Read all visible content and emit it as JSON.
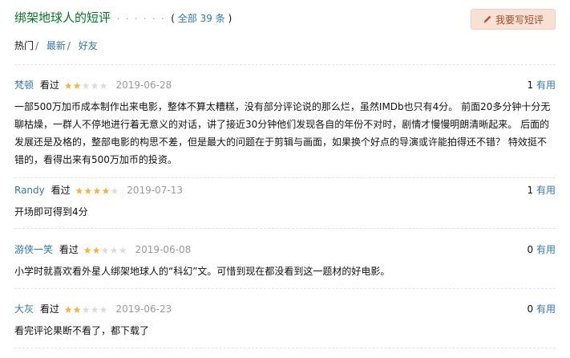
{
  "header": {
    "title": "绑架地球人的短评",
    "dots": "· · · · · ·",
    "count_prefix": "全部",
    "count_value": "39",
    "count_suffix": "条",
    "write_button": "我要写短评",
    "write_icon": "pencil-icon"
  },
  "tabs": [
    {
      "label": "热门",
      "active": true
    },
    {
      "label": "最新",
      "active": false
    },
    {
      "label": "好友",
      "active": false
    }
  ],
  "rating_colors": {
    "star_on": "#f7b13c",
    "star_off": "#dcdcdc",
    "link": "#37a"
  },
  "comments": [
    {
      "author": "梵顿",
      "status": "看过",
      "rating": 2,
      "date": "2019-06-28",
      "votes": "1",
      "vote_label": "有用",
      "content": "一部500万加币成本制作出来电影，整体不算太糟糕，没有部分评论说的那么烂，虽然IMDb也只有4分。 前面20多分钟十分无聊枯燥，一群人不停地进行着无意义的对话，讲了接近30分钟他们发现各自的年份不对时，剧情才慢慢明朗清晰起来。 后面的发展还是及格的，整部电影的构思不差，但是最大的问题在于剪辑与画面，如果换个好点的导演或许能拍得还不错？ 特效挺不错的，看得出来有500万加币的投资。"
    },
    {
      "author": "Randy",
      "status": "看过",
      "rating": 4,
      "date": "2019-07-13",
      "votes": "1",
      "vote_label": "有用",
      "content": "开场即可得到4分"
    },
    {
      "author": "游侠一笑",
      "status": "看过",
      "rating": 2,
      "date": "2019-06-08",
      "votes": "0",
      "vote_label": "有用",
      "content": "小学时就喜欢看外星人绑架地球人的“科幻”文。可惜到现在都没看到这一题材的好电影。"
    },
    {
      "author": "大灰",
      "status": "看过",
      "rating": 2,
      "date": "2019-06-23",
      "votes": "0",
      "vote_label": "有用",
      "content": "看完评论果断不看了，都下载了"
    }
  ]
}
